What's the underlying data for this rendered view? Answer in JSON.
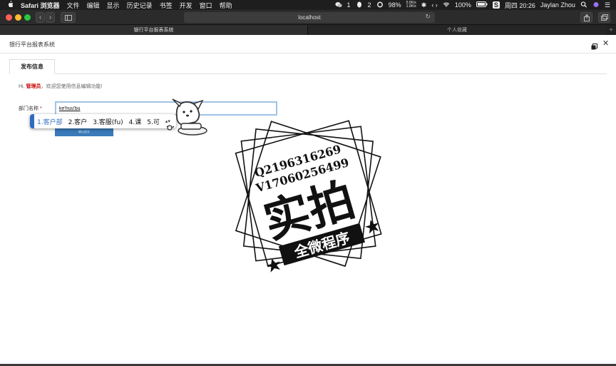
{
  "menubar": {
    "app": "Safari 浏览器",
    "menus": [
      "文件",
      "编辑",
      "显示",
      "历史记录",
      "书签",
      "开发",
      "窗口",
      "帮助"
    ],
    "status": {
      "wechat_count": "1",
      "qq_count": "2",
      "cpu": "98%",
      "net_up": "0.0K/s",
      "net_down": "1.0K/s",
      "battery": "100%",
      "clock": "周四 20:26",
      "user": "Jaylan Zhou"
    }
  },
  "browser": {
    "url": "localhost",
    "tabs": [
      {
        "label": "银行平台报表系统",
        "active": true
      },
      {
        "label": "个人收藏",
        "active": false
      }
    ],
    "new_tab": "+"
  },
  "page": {
    "system_title": "银行平台报表系统",
    "tab_label": "发布信息",
    "greeting_prefix": "Hi,",
    "admin_name": "管理员",
    "greeting_suffix": "，欢迎您使用信息编辑功能!",
    "dept_label": "部门名称",
    "required_mark": "*",
    "dept_value": "ke'huu'bu",
    "submit_label": "确认提交"
  },
  "ime": {
    "candidates": [
      "1.客户部",
      "2.客户",
      "3.客服(fu)",
      "4.课",
      "5.可"
    ],
    "selected_index": 0,
    "arrows": "▴▾"
  },
  "stamp": {
    "line1": "Q2196316269",
    "line2": "V17060256499",
    "big": "实拍",
    "banner": "全微程序"
  },
  "colors": {
    "accent": "#2f6cc0",
    "required": "#cc0000",
    "input_focus": "#9fc3e6"
  },
  "icons": [
    "apple-icon",
    "wechat-icon",
    "qq-icon",
    "bluetooth-icon",
    "wifi-icon",
    "battery-icon",
    "search-icon",
    "siri-icon",
    "list-icon",
    "share-icon",
    "tabs-icon",
    "sidebar-icon",
    "reload-icon",
    "restore-icon",
    "close-icon"
  ]
}
